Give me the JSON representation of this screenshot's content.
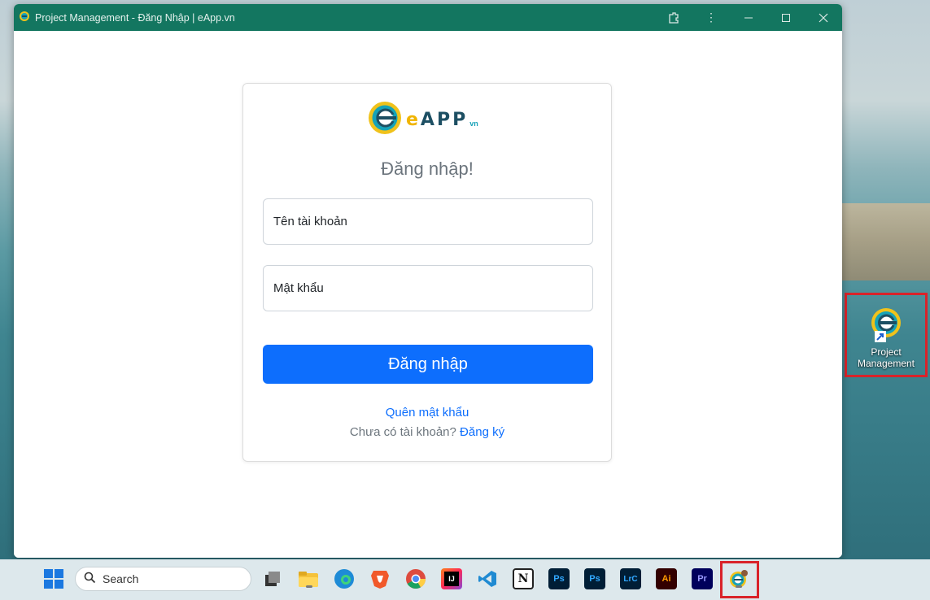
{
  "window": {
    "title": "Project Management - Đăng Nhập | eApp.vn",
    "controls": [
      "extensions-icon",
      "more-icon",
      "minimize-icon",
      "maximize-icon",
      "close-icon"
    ]
  },
  "login": {
    "brand_prefix": "e",
    "brand_name": "APP",
    "brand_suffix": "vn",
    "heading": "Đăng nhập!",
    "username_placeholder": "Tên tài khoản",
    "password_placeholder": "Mật khẩu",
    "submit_label": "Đăng nhập",
    "forgot_label": "Quên mật khẩu",
    "no_account_text": "Chưa có tài khoản?",
    "register_label": "Đăng ký",
    "colors": {
      "primary": "#0d6efd",
      "muted": "#6c757d",
      "titlebar": "#137660"
    }
  },
  "desktop": {
    "shortcut_label_line1": "Project",
    "shortcut_label_line2": "Management"
  },
  "taskbar": {
    "search_label": "Search",
    "apps": [
      {
        "name": "task-view",
        "label": ""
      },
      {
        "name": "file-explorer",
        "label": ""
      },
      {
        "name": "edge",
        "label": ""
      },
      {
        "name": "brave",
        "label": ""
      },
      {
        "name": "chrome",
        "label": ""
      },
      {
        "name": "intellij",
        "label": "IJ"
      },
      {
        "name": "vscode",
        "label": ""
      },
      {
        "name": "notion",
        "label": "N"
      },
      {
        "name": "photoshop",
        "label": "Ps"
      },
      {
        "name": "photoshop-2",
        "label": "Ps"
      },
      {
        "name": "lightroom-classic",
        "label": "LrC"
      },
      {
        "name": "illustrator",
        "label": "Ai"
      },
      {
        "name": "premiere",
        "label": "Pr"
      },
      {
        "name": "project-management",
        "label": ""
      }
    ]
  }
}
